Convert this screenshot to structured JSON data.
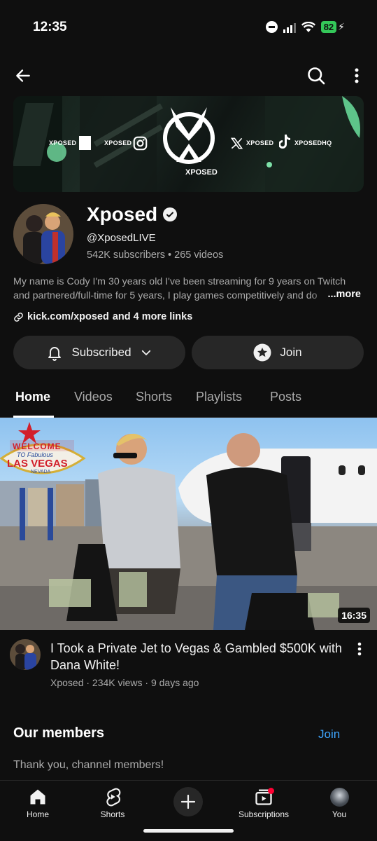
{
  "status_bar": {
    "time": "12:35",
    "battery": "82"
  },
  "top_nav": {
    "back_icon": "arrow-left-icon",
    "search_icon": "search-icon",
    "menu_icon": "more-vert-icon"
  },
  "banner": {
    "left_items": [
      {
        "text": "XPOSED",
        "icon": "kick-icon"
      },
      {
        "text": "XPOSED",
        "icon": "instagram-icon"
      }
    ],
    "logo_text": "XPOSED",
    "right_items": [
      {
        "text": "XPOSED",
        "icon": "x-icon"
      },
      {
        "text": "XPOSEDHQ",
        "icon": "tiktok-icon"
      }
    ]
  },
  "channel": {
    "name": "Xposed",
    "handle": "@XposedLIVE",
    "meta": "542K subscribers • 265 videos",
    "description_line1": "My name is Cody I'm 30 years old I've been streaming for 9 years on Twitch",
    "description_line2": "and partnered/full-time for 5 years, I play games competitively and do",
    "more_label": "...more",
    "link_url": "kick.com/xposed",
    "link_more": "and 4 more links"
  },
  "buttons": {
    "subscribed_label": "Subscribed",
    "join_label": "Join"
  },
  "tabs": [
    {
      "label": "Home",
      "active": true
    },
    {
      "label": "Videos",
      "active": false
    },
    {
      "label": "Shorts",
      "active": false
    },
    {
      "label": "Playlists",
      "active": false
    },
    {
      "label": "Posts",
      "active": false
    }
  ],
  "featured_video": {
    "duration": "16:35",
    "sign_line1": "WELCOME",
    "sign_line2": "TO Fabulous",
    "sign_line3": "LAS VEGAS",
    "sign_line4": "NEVADA",
    "title": "I Took a Private Jet to Vegas & Gambled $500K with Dana White!",
    "meta": "Xposed · 234K views · 9 days ago"
  },
  "members": {
    "title": "Our members",
    "join_label": "Join",
    "subtitle": "Thank you, channel members!"
  },
  "bottom_nav": [
    {
      "label": "Home",
      "icon": "home-icon"
    },
    {
      "label": "Shorts",
      "icon": "shorts-icon"
    },
    {
      "label": "",
      "icon": "create-icon"
    },
    {
      "label": "Subscriptions",
      "icon": "subscriptions-icon"
    },
    {
      "label": "You",
      "icon": "avatar"
    }
  ],
  "colors": {
    "background": "#0f0f0f",
    "button": "#272727",
    "link_blue": "#3ea6ff",
    "battery_green": "#34c759"
  }
}
